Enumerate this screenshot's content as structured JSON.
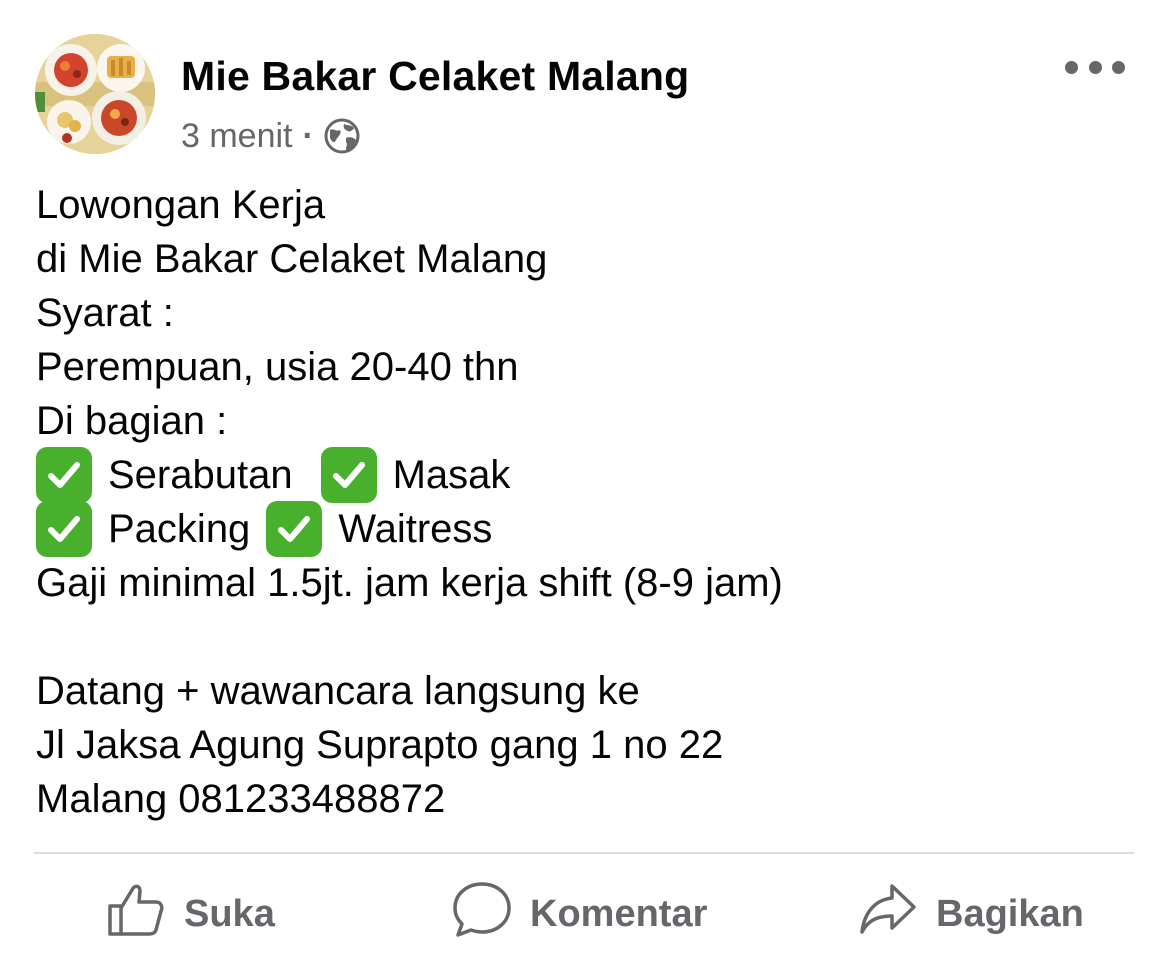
{
  "post": {
    "author": "Mie Bakar Celaket Malang",
    "time": "3 menit",
    "separator": "·",
    "privacy_icon": "globe-icon",
    "more_icon": "more-horizontal-icon",
    "lines": {
      "l1": "Lowongan Kerja",
      "l2": "di Mie Bakar Celaket Malang",
      "l3": "Syarat :",
      "l4": "Perempuan, usia 20-40 thn",
      "l5": "Di bagian :",
      "role1": "Serabutan",
      "role2": "Masak",
      "role3": "Packing",
      "role4": "Waitress",
      "l8": "Gaji minimal 1.5jt. jam kerja shift (8-9 jam)",
      "l10": "Datang + wawancara langsung ke",
      "l11": "Jl Jaksa Agung Suprapto gang 1 no 22",
      "l12": "Malang 081233488872"
    }
  },
  "actions": {
    "like": "Suka",
    "comment": "Komentar",
    "share": "Bagikan"
  },
  "colors": {
    "text": "#050505",
    "secondary": "#65676b",
    "check_green": "#48b02c",
    "divider": "#dcdde1"
  }
}
